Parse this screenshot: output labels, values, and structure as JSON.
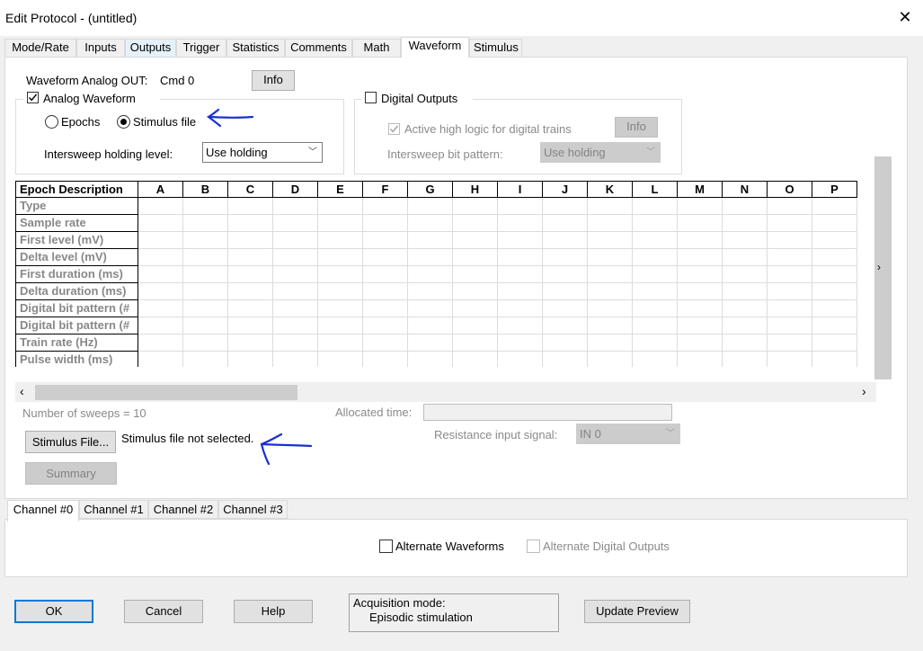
{
  "window": {
    "title": "Edit Protocol - (untitled)"
  },
  "tabs": [
    "Mode/Rate",
    "Inputs",
    "Outputs",
    "Trigger",
    "Statistics",
    "Comments",
    "Math",
    "Waveform",
    "Stimulus"
  ],
  "active_tab": "Waveform",
  "waveform": {
    "analog_out_label": "Waveform Analog OUT:",
    "analog_out_value": "Cmd 0",
    "info_button": "Info",
    "analog_group": {
      "checkbox_label": "Analog Waveform",
      "checked": true,
      "radio_epochs": "Epochs",
      "radio_stimulus": "Stimulus file",
      "selected": "Stimulus file",
      "intersweep_label": "Intersweep holding level:",
      "intersweep_value": "Use holding"
    },
    "digital_group": {
      "checkbox_label": "Digital Outputs",
      "checked": false,
      "active_high_label": "Active high logic for digital trains",
      "active_high_checked": true,
      "info_button": "Info",
      "bit_pattern_label": "Intersweep bit pattern:",
      "bit_pattern_value": "Use holding"
    },
    "table": {
      "corner": "Epoch Description",
      "columns": [
        "A",
        "B",
        "C",
        "D",
        "E",
        "F",
        "G",
        "H",
        "I",
        "J",
        "K",
        "L",
        "M",
        "N",
        "O",
        "P"
      ],
      "rows": [
        "Type",
        "Sample rate",
        "First level (mV)",
        "Delta level (mV)",
        "First duration (ms)",
        "Delta duration (ms)",
        "Digital bit pattern (#",
        "Digital bit pattern (#",
        "Train rate (Hz)",
        "Pulse width (ms)"
      ]
    },
    "sweeps_label": "Number of sweeps = 10",
    "allocated_time_label": "Allocated time:",
    "stimulus_file_button": "Stimulus File...",
    "stimulus_status": "Stimulus file not selected.",
    "resistance_label": "Resistance input signal:",
    "resistance_value": "IN 0",
    "summary_button": "Summary"
  },
  "channel_tabs": [
    "Channel #0",
    "Channel #1",
    "Channel #2",
    "Channel #3"
  ],
  "active_channel": "Channel #0",
  "alternate_waveforms": "Alternate Waveforms",
  "alternate_digital": "Alternate Digital Outputs",
  "footer": {
    "ok": "OK",
    "cancel": "Cancel",
    "help": "Help",
    "acq_label": "Acquisition mode:",
    "acq_value": "Episodic stimulation",
    "update_preview": "Update Preview"
  },
  "colors": {
    "accent": "#0078d7",
    "annotation": "#1a2fd6"
  },
  "annotations": [
    "left-arrow-icon",
    "left-arrow-icon"
  ]
}
